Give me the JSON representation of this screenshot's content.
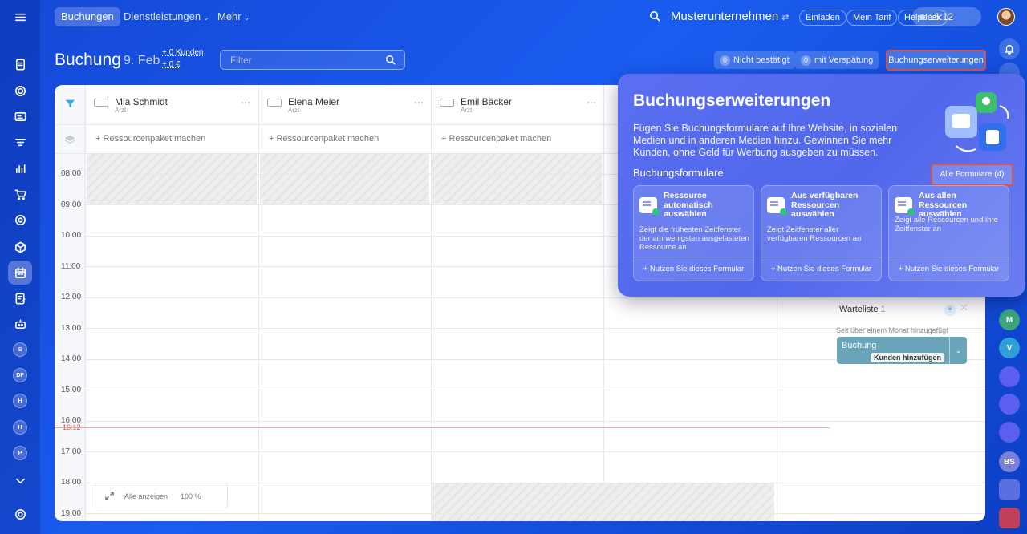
{
  "topbar": {
    "tabs": [
      {
        "label": "Buchungen"
      },
      {
        "label": "Dienstleistungen"
      },
      {
        "label": "Mehr"
      }
    ],
    "company": "Musterunternehmen",
    "buttons": [
      "Einladen",
      "Mein Tarif",
      "Helpdesk"
    ],
    "time": "16:12"
  },
  "header": {
    "title": "Buchung",
    "date": "9. Feb",
    "stat_customers": "+ 0 Kunden",
    "stat_money": "+ 0 €",
    "filter_placeholder": "Filter",
    "not_confirmed_count": "0",
    "not_confirmed_label": "Nicht bestätigt",
    "late_count": "0",
    "late_label": "mit Verspätung",
    "extensions_button": "Buchungserweiterungen"
  },
  "calendar": {
    "resources": [
      {
        "name": "Mia Schmidt",
        "role": "Arzt"
      },
      {
        "name": "Elena Meier",
        "role": "Arzt"
      },
      {
        "name": "Emil Bäcker",
        "role": "Arzt"
      }
    ],
    "package_label": "+ Ressourcenpaket machen",
    "hours": [
      "08:00",
      "09:00",
      "10:00",
      "11:00",
      "12:00",
      "13:00",
      "14:00",
      "15:00",
      "16:00",
      "17:00",
      "18:00",
      "19:00"
    ],
    "now": "16:12",
    "zoom": {
      "show_all": "Alle anzeigen",
      "percent": "100 %"
    }
  },
  "waitlist": {
    "title": "Warteliste",
    "count": "1",
    "note": "Seit über einem Monat hinzugefügt",
    "card_title": "Buchung",
    "card_button": "Kunden hinzufügen"
  },
  "popup": {
    "title": "Buchungserweiterungen",
    "description": "Fügen Sie Buchungsformulare auf Ihre Website, in sozialen Medien und in anderen Medien hinzu. Gewinnen Sie mehr Kunden, ohne Geld für Werbung ausgeben zu müssen.",
    "subtitle": "Buchungsformulare",
    "all_forms": "Alle Formulare (4)",
    "forms": [
      {
        "title": "Ressource automatisch auswählen",
        "text": "Zeigt die frühesten Zeitfenster der am wenigsten ausgelasteten Ressource an",
        "action": "+ Nutzen Sie dieses Formular"
      },
      {
        "title": "Aus verfügbaren Ressourcen auswählen",
        "text": "Zeigt Zeitfenster aller verfügbaren Ressourcen an",
        "action": "+ Nutzen Sie dieses Formular"
      },
      {
        "title": "Aus allen Ressourcen auswählen",
        "text": "Zeigt alle Ressourcen und ihre Zeitfenster an",
        "action": "+ Nutzen Sie dieses Formular"
      }
    ]
  },
  "left_rail": {
    "initials": [
      "S",
      "DF",
      "H",
      "H",
      "P"
    ]
  },
  "right_rail": {
    "initials": [
      "M",
      "V",
      "BS"
    ]
  },
  "colors": {
    "accent": "#1a5cf0",
    "popup": "#5a6ff0",
    "highlight_border": "#d9534f",
    "now_line": "#e05a4c"
  }
}
